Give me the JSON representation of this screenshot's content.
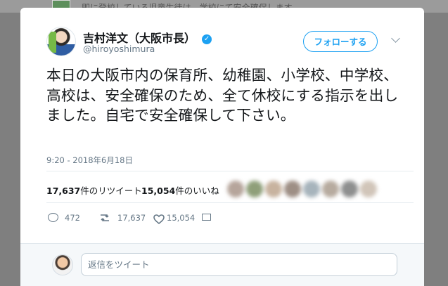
{
  "background": {
    "text": "即に登校している児童生徒は、学校にて安全確保します"
  },
  "tweet": {
    "display_name": "吉村洋文（大阪市長）",
    "handle": "@hiroyoshimura",
    "verified_icon": "verified-badge-icon",
    "follow_label": "フォローする",
    "more_icon": "chevron-down-icon",
    "text": "本日の大阪市内の保育所、幼稚園、小学校、中学校、高校は、安全確保のため、全て休校にする指示を出しました。自宅で安全確保して下さい。",
    "time_date": "9:20 - 2018年6月18日",
    "retweets_count": "17,637",
    "retweets_label": "件のリツイート",
    "likes_count": "15,054",
    "likes_label": "件のいいね",
    "reply_count": "472",
    "retweet_action_count": "17,637",
    "like_action_count": "15,054",
    "reply_placeholder": "返信をツイート",
    "colors": {
      "accent": "#1da1f2",
      "muted": "#657786",
      "divider": "#e6ecf0"
    }
  }
}
